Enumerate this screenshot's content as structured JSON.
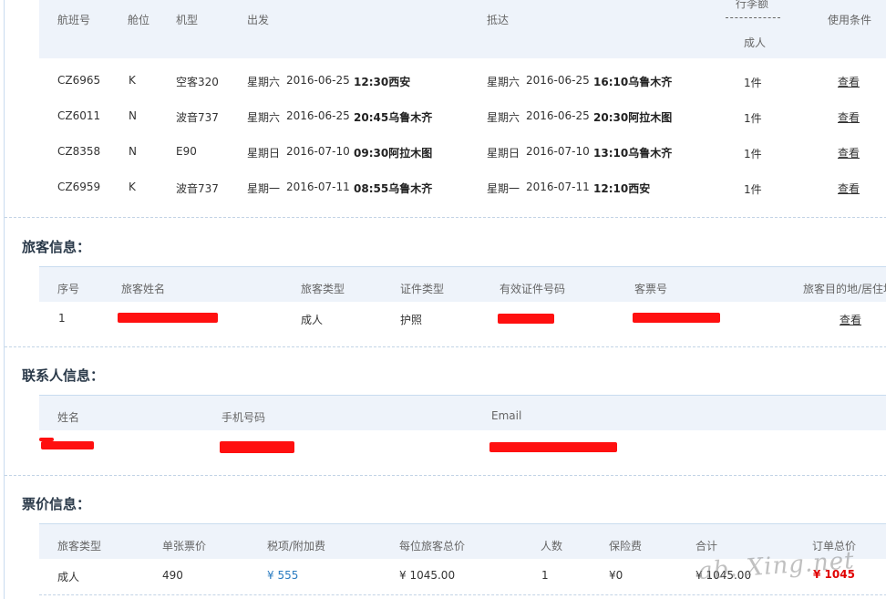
{
  "flights": {
    "headers": {
      "flight_no": "航班号",
      "cabin": "舱位",
      "model": "机型",
      "depart": "出发",
      "arrive": "抵达",
      "luggage": "行李额",
      "luggage_sub": "成人",
      "rules": "使用条件"
    },
    "rows": [
      {
        "flight_no": "CZ6965",
        "cabin": "K",
        "model": "空客320",
        "dep_day": "星期六",
        "dep_date": "2016-06-25",
        "dep_time_city": "12:30西安",
        "arr_day": "星期六",
        "arr_date": "2016-06-25",
        "arr_time_city": "16:10乌鲁木齐",
        "luggage": "1件",
        "link": "查看"
      },
      {
        "flight_no": "CZ6011",
        "cabin": "N",
        "model": "波音737",
        "dep_day": "星期六",
        "dep_date": "2016-06-25",
        "dep_time_city": "20:45乌鲁木齐",
        "arr_day": "星期六",
        "arr_date": "2016-06-25",
        "arr_time_city": "20:30阿拉木图",
        "luggage": "1件",
        "link": "查看"
      },
      {
        "flight_no": "CZ8358",
        "cabin": "N",
        "model": "E90",
        "dep_day": "星期日",
        "dep_date": "2016-07-10",
        "dep_time_city": "09:30阿拉木图",
        "arr_day": "星期日",
        "arr_date": "2016-07-10",
        "arr_time_city": "13:10乌鲁木齐",
        "luggage": "1件",
        "link": "查看"
      },
      {
        "flight_no": "CZ6959",
        "cabin": "K",
        "model": "波音737",
        "dep_day": "星期一",
        "dep_date": "2016-07-11",
        "dep_time_city": "08:55乌鲁木齐",
        "arr_day": "星期一",
        "arr_date": "2016-07-11",
        "arr_time_city": "12:10西安",
        "luggage": "1件",
        "link": "查看"
      }
    ]
  },
  "passengers": {
    "title": "旅客信息：",
    "headers": {
      "seq": "序号",
      "name": "旅客姓名",
      "type": "旅客类型",
      "id_type": "证件类型",
      "id_no": "有效证件号码",
      "ticket_no": "客票号",
      "destination": "旅客目的地/居住地"
    },
    "rows": [
      {
        "seq": "1",
        "type": "成人",
        "id_type": "护照",
        "link": "查看"
      }
    ]
  },
  "contact": {
    "title": "联系人信息：",
    "headers": {
      "name": "姓名",
      "phone": "手机号码",
      "email": "Email"
    }
  },
  "price": {
    "title": "票价信息：",
    "headers": {
      "pax_type": "旅客类型",
      "unit_price": "单张票价",
      "tax": "税项/附加费",
      "per_pax_total": "每位旅客总价",
      "count": "人数",
      "insurance": "保险费",
      "subtotal": "合计",
      "order_total": "订单总价"
    },
    "rows": [
      {
        "pax_type": "成人",
        "unit_price": "490",
        "tax": "¥ 555",
        "per_pax_total": "¥ 1045.00",
        "count": "1",
        "insurance": "¥0",
        "subtotal": "¥ 1045.00",
        "order_total": "¥ 1045"
      }
    ]
  },
  "watermark": "ab. Xing.net",
  "colors": {
    "accent": "#1a6fb0",
    "header_bg": "#eef3fa",
    "redaction": "#ff1010",
    "total": "#e00000"
  }
}
